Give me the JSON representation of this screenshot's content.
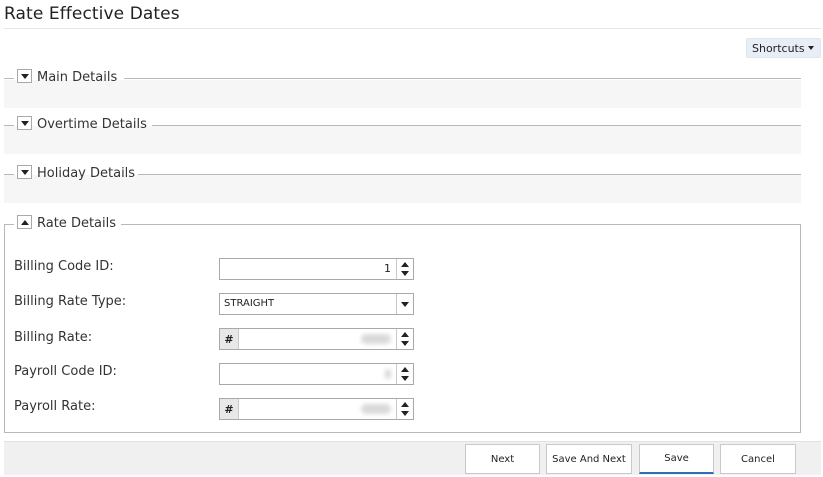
{
  "page": {
    "title": "Rate Effective Dates"
  },
  "toolbar": {
    "shortcuts_label": "Shortcuts"
  },
  "sections": {
    "main": {
      "label": "Main Details",
      "expanded": false
    },
    "overtime": {
      "label": "Overtime Details",
      "expanded": false
    },
    "holiday": {
      "label": "Holiday Details",
      "expanded": false
    },
    "rate": {
      "label": "Rate Details",
      "expanded": true
    }
  },
  "rate_details": {
    "billing_code_id": {
      "label": "Billing Code ID:",
      "value": "1"
    },
    "billing_rate_type": {
      "label": "Billing Rate Type:",
      "value": "STRAIGHT"
    },
    "billing_rate": {
      "label": "Billing Rate:",
      "prefix": "#",
      "value": ""
    },
    "payroll_code_id": {
      "label": "Payroll Code ID:",
      "value": ""
    },
    "payroll_rate": {
      "label": "Payroll Rate:",
      "prefix": "#",
      "value": ""
    }
  },
  "actions": {
    "next": "Next",
    "save_and_next": "Save And Next",
    "save": "Save",
    "cancel": "Cancel"
  },
  "colors": {
    "accent": "#2f6db5",
    "section_band": "#f6f6f6",
    "shortcuts_bg": "#e7eef6"
  }
}
